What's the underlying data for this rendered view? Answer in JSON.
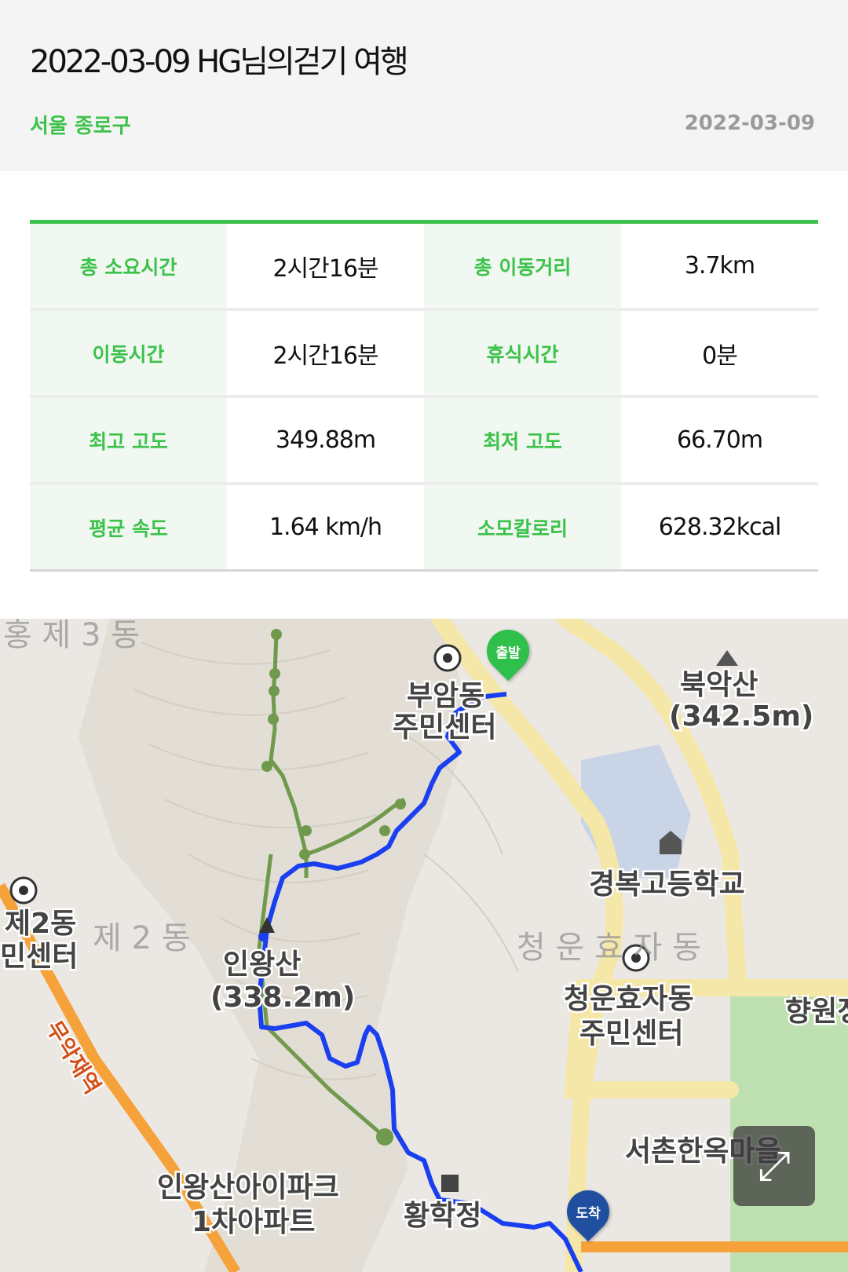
{
  "header": {
    "title": "2022-03-09 HG님의걷기 여행",
    "region": "서울 종로구",
    "date": "2022-03-09"
  },
  "stats": [
    {
      "label1": "총 소요시간",
      "value1": "2시간16분",
      "label2": "총 이동거리",
      "value2": "3.7km"
    },
    {
      "label1": "이동시간",
      "value1": "2시간16분",
      "label2": "휴식시간",
      "value2": "0분"
    },
    {
      "label1": "최고 고도",
      "value1": "349.88m",
      "label2": "최저 고도",
      "value2": "66.70m"
    },
    {
      "label1": "평균 속도",
      "value1": "1.64 km/h",
      "label2": "소모칼로리",
      "value2": "628.32kcal"
    }
  ],
  "map": {
    "start_label": "출발",
    "end_label": "도착",
    "labels": {
      "hong3": "홍 제 3 동",
      "buam1": "부암동",
      "buam2": "주민센터",
      "bukak1": "북악산",
      "bukak2": "(342.5m)",
      "gyeongbok": "경복고등학교",
      "cheongun_area": "청 운 효 자 동",
      "cheongun1": "청운효자동",
      "cheongun2": "주민센터",
      "hong2_1": "제2동",
      "hong2_2": "민센터",
      "hong2_area": "제 2 동",
      "inwang1": "인왕산",
      "inwang2": "(338.2m)",
      "muak": "무악재역",
      "hyangwon": "향원정",
      "seochon": "서촌한옥마을",
      "ipark1": "인왕산아이파크",
      "ipark2": "1차아파트",
      "hwanghak": "황학정"
    },
    "colors": {
      "route": "#1a3ff0",
      "trail": "#6f9a4e",
      "start": "#2fbf4b",
      "end": "#1f4f9e"
    }
  }
}
